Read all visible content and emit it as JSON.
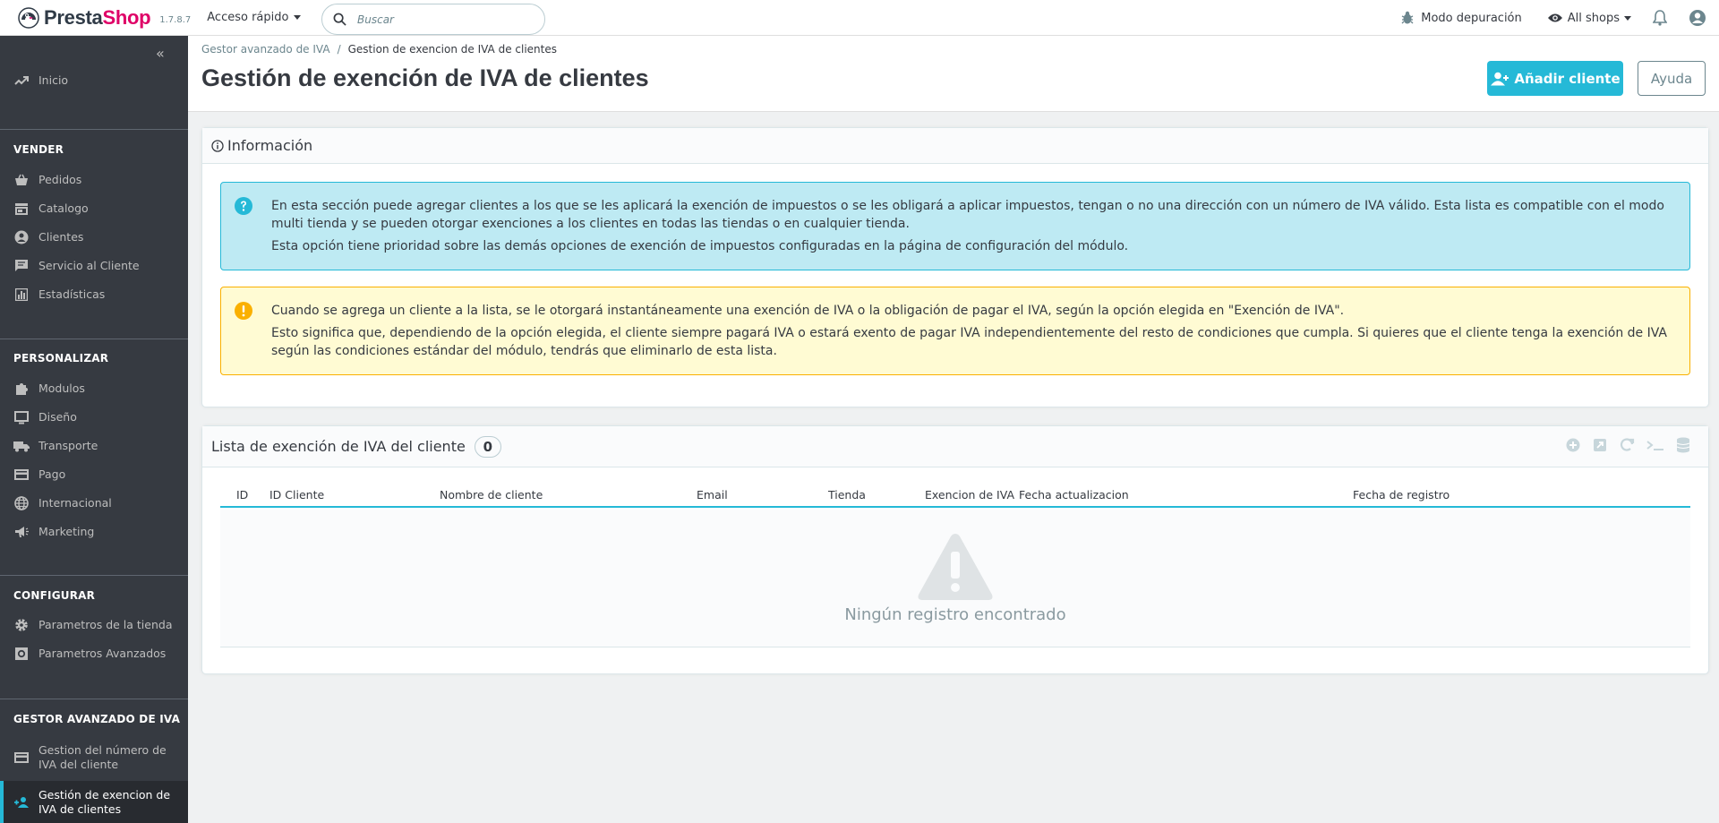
{
  "header": {
    "logo_part1": "Presta",
    "logo_part2": "Shop",
    "version": "1.7.8.7",
    "quick_access": "Acceso rápido",
    "search_placeholder": "Buscar",
    "debug_mode": "Modo depuración",
    "shops": "All shops"
  },
  "sidebar": {
    "home": "Inicio",
    "sell_title": "VENDER",
    "sell_items": [
      "Pedidos",
      "Catalogo",
      "Clientes",
      "Servicio al Cliente",
      "Estadísticas"
    ],
    "customize_title": "PERSONALIZAR",
    "customize_items": [
      "Modulos",
      "Diseño",
      "Transporte",
      "Pago",
      "Internacional",
      "Marketing"
    ],
    "configure_title": "CONFIGURAR",
    "configure_items": [
      "Parametros de la tienda",
      "Parametros Avanzados"
    ],
    "vat_title": "GESTOR AVANZADO DE IVA",
    "vat_items": [
      "Gestion del número de IVA del cliente",
      "Gestión de exencion de IVA de clientes"
    ]
  },
  "page": {
    "breadcrumb_parent": "Gestor avanzado de IVA",
    "breadcrumb_current": "Gestion de exencion de IVA de clientes",
    "title": "Gestión de exención de IVA de clientes",
    "add_button": "Añadir cliente",
    "help_button": "Ayuda"
  },
  "info_panel": {
    "title": "Información",
    "info_p1": "En esta sección puede agregar clientes a los que se les aplicará la exención de impuestos o se les obligará a aplicar impuestos, tengan o no una dirección con un número de IVA válido. Esta lista es compatible con el modo multi tienda y se pueden otorgar exenciones a los clientes en todas las tiendas o en cualquier tienda.",
    "info_p2": "Esta opción tiene prioridad sobre las demás opciones de exención de impuestos configuradas en la página de configuración del módulo.",
    "warn_p1": "Cuando se agrega un cliente a la lista, se le otorgará instantáneamente una exención de IVA o la obligación de pagar el IVA, según la opción elegida en \"Exención de IVA\".",
    "warn_p2": "Esto significa que, dependiendo de la opción elegida, el cliente siempre pagará IVA o estará exento de pagar IVA independientemente del resto de condiciones que cumpla. Si quieres que el cliente tenga la exención de IVA según las condiciones estándar del módulo, tendrás que eliminarlo de esta lista."
  },
  "list_panel": {
    "title": "Lista de exención de IVA del cliente",
    "count": "0",
    "columns": [
      "ID",
      "ID Cliente",
      "Nombre de cliente",
      "Email",
      "Tienda",
      "Exencion de IVA",
      "Fecha actualizacion",
      "Fecha de registro"
    ],
    "empty_message": "Ningún registro encontrado",
    "tools": [
      "add-new-icon",
      "export-icon",
      "refresh-icon",
      "sql-query-icon",
      "database-icon"
    ]
  },
  "colors": {
    "accent": "#25b9d7",
    "sidebar_bg": "#363a41",
    "info_bg": "#beeaf3",
    "warning_bg": "#fffbd3",
    "warning_icon": "#fab000",
    "brand_pink": "#df0067"
  }
}
